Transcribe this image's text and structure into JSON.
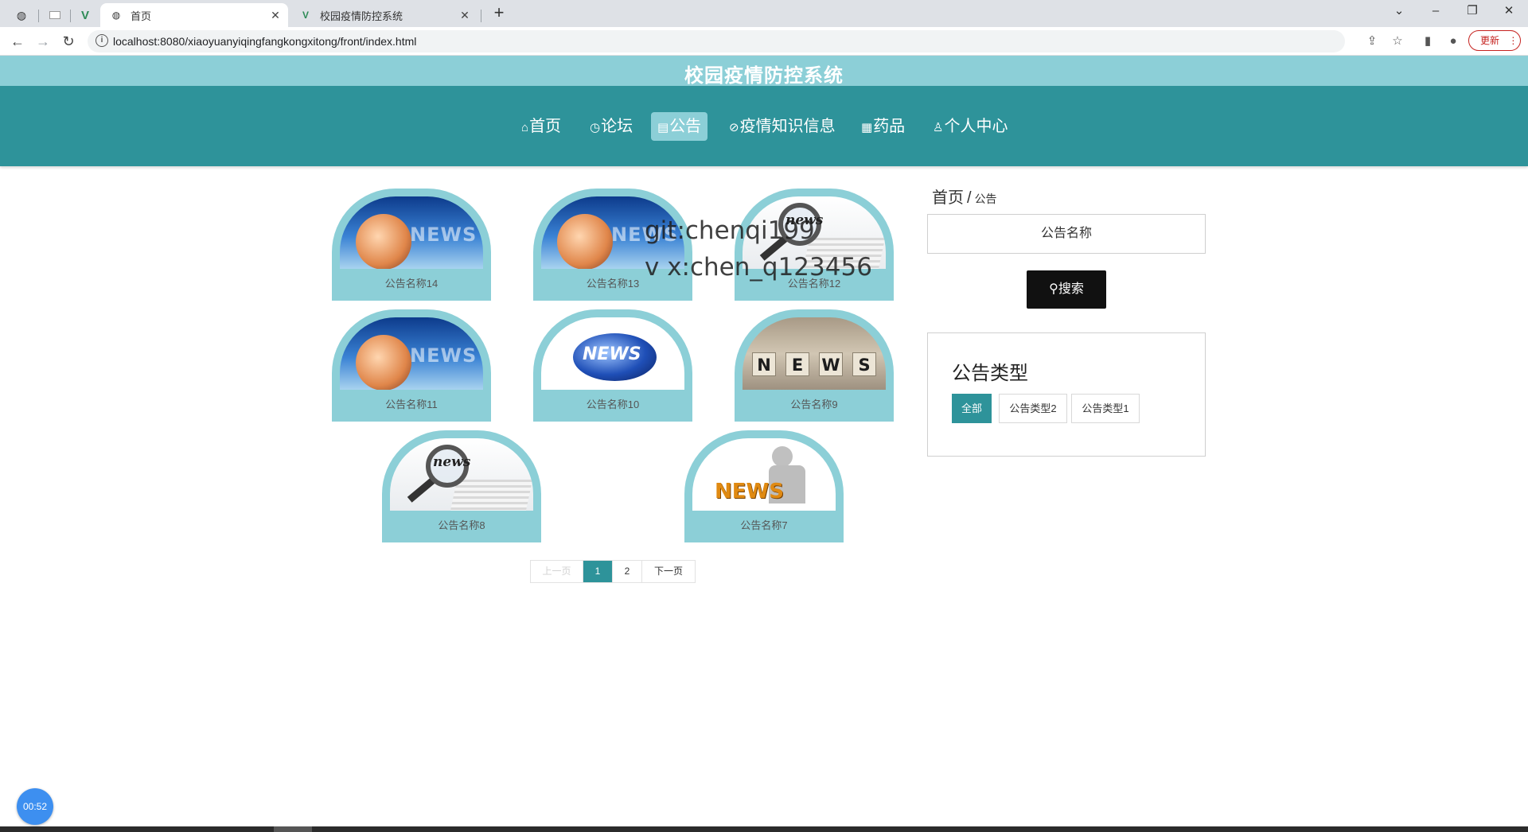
{
  "browser": {
    "tabs": [
      {
        "title": "首页",
        "active": true
      },
      {
        "title": "校园疫情防控系统",
        "active": false
      }
    ],
    "url": "localhost:8080/xiaoyuanyiqingfangkongxitong/front/index.html",
    "update_label": "更新"
  },
  "site": {
    "title": "校园疫情防控系统",
    "nav": [
      {
        "label": "首页",
        "icon": "home-icon"
      },
      {
        "label": "论坛",
        "icon": "clock-icon"
      },
      {
        "label": "公告",
        "icon": "notice-icon",
        "active": true
      },
      {
        "label": "疫情知识信息",
        "icon": "link-icon"
      },
      {
        "label": "药品",
        "icon": "grid-icon"
      },
      {
        "label": "个人中心",
        "icon": "user-icon"
      }
    ]
  },
  "news": [
    {
      "name": "公告名称14",
      "image": "globe-news"
    },
    {
      "name": "公告名称13",
      "image": "globe-news"
    },
    {
      "name": "公告名称12",
      "image": "magnifier-paper"
    },
    {
      "name": "公告名称11",
      "image": "globe-news"
    },
    {
      "name": "公告名称10",
      "image": "blue-globe"
    },
    {
      "name": "公告名称9",
      "image": "news-cubes"
    },
    {
      "name": "公告名称8",
      "image": "magnifier-paper"
    },
    {
      "name": "公告名称7",
      "image": "orange-news"
    }
  ],
  "pagination": {
    "prev": "上一页",
    "pages": [
      "1",
      "2"
    ],
    "current": "1",
    "next": "下一页"
  },
  "watermark": {
    "line1": "git:chenqi199",
    "line2": "v x:chen_q123456"
  },
  "sidebar": {
    "breadcrumb": {
      "home": "首页",
      "sep": "/",
      "current": "公告"
    },
    "search_placeholder": "公告名称",
    "search_label": "搜索",
    "type_title": "公告类型",
    "types": [
      {
        "label": "全部",
        "active": true
      },
      {
        "label": "公告类型2",
        "active": false
      },
      {
        "label": "公告类型1",
        "active": false
      }
    ]
  },
  "timer": "00:52",
  "colors": {
    "header_light": "#8ccfd7",
    "nav_teal": "#2e939a",
    "search_button": "#111111",
    "timer_blue": "#3d8ff0"
  }
}
